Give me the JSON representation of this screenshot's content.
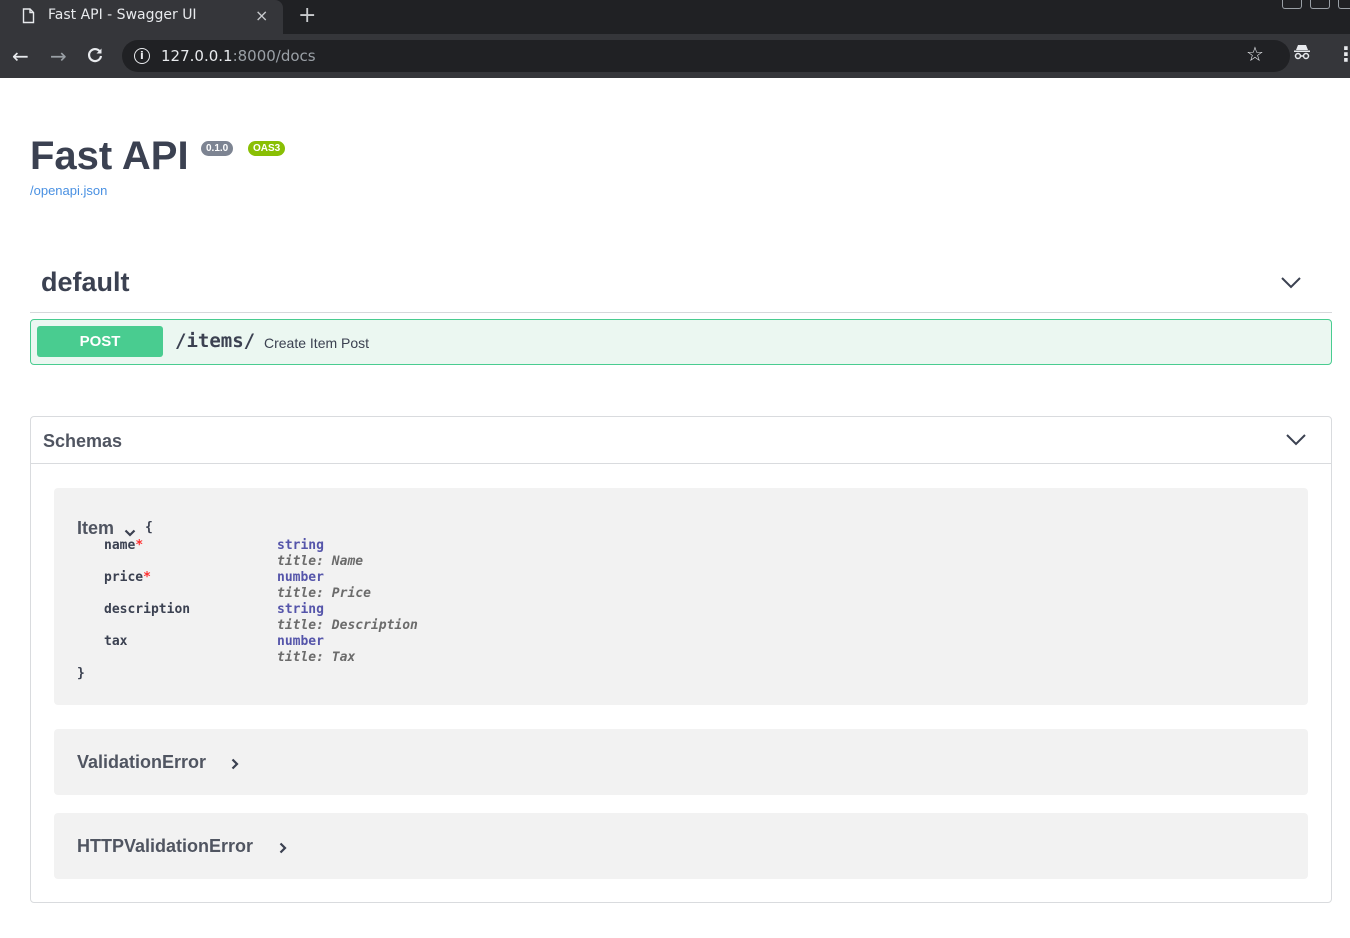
{
  "browser": {
    "tab_title": "Fast API - Swagger UI",
    "tab_close": "×",
    "new_tab": "+",
    "url_host": "127.0.0.1",
    "url_path": ":8000/docs"
  },
  "info": {
    "title": "Fast API",
    "version_badge": "0.1.0",
    "oas_badge": "OAS3",
    "spec_link": "/openapi.json"
  },
  "tag": {
    "name": "default"
  },
  "operation": {
    "method": "POST",
    "path": "/items/",
    "summary": "Create Item Post"
  },
  "schemas": {
    "header": "Schemas",
    "item": {
      "name": "Item",
      "open_brace": "{",
      "close_brace": "}",
      "properties": [
        {
          "name": "name",
          "required": "*",
          "type": "string",
          "title": "title: Name"
        },
        {
          "name": "price",
          "required": "*",
          "type": "number",
          "title": "title: Price"
        },
        {
          "name": "description",
          "required": "",
          "type": "string",
          "title": "title: Description"
        },
        {
          "name": "tax",
          "required": "",
          "type": "number",
          "title": "title: Tax"
        }
      ]
    },
    "collapsed": [
      {
        "name": "ValidationError"
      },
      {
        "name": "HTTPValidationError"
      }
    ]
  },
  "colors": {
    "post_green": "#49cc90",
    "post_bg": "#ebf7f1",
    "link_blue": "#4990e2",
    "required_red": "#ff2f2f",
    "type_blue": "#5555aa"
  }
}
